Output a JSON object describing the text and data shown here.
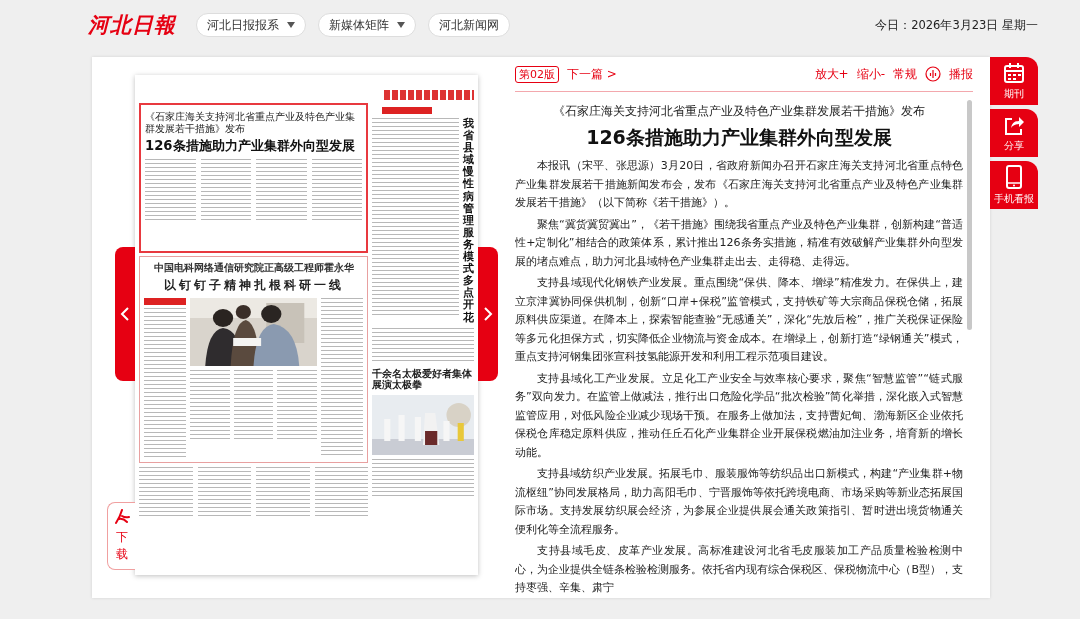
{
  "header": {
    "logo": "河北日報",
    "nav": [
      {
        "label": "河北日报报系",
        "dropdown": true
      },
      {
        "label": "新媒体矩阵",
        "dropdown": true
      },
      {
        "label": "河北新闻网",
        "dropdown": false
      }
    ],
    "date": "今日：2026年3月23日 星期一"
  },
  "newspaper": {
    "lead": {
      "kicker": "《石家庄海关支持河北省重点产业及特色产业集群发展若干措施》发布",
      "headline": "126条措施助力产业集群外向型发展"
    },
    "feature": {
      "kicker": "中国电科网络通信研究院正高级工程师霍永华",
      "headline": "以钉钉子精神扎根科研一线"
    },
    "side_headline": "我省县域慢性病管理服务模式多点开花",
    "photo_story": {
      "headline": "千余名太极爱好者集体展演太极拳"
    }
  },
  "download": "下载",
  "toolbar": {
    "page_badge": "第02版",
    "next": "下一篇 >",
    "zoom_in": "放大+",
    "zoom_out": "缩小-",
    "normal": "常规",
    "play": "播报"
  },
  "article": {
    "kicker": "《石家庄海关支持河北省重点产业及特色产业集群发展若干措施》发布",
    "title": "126条措施助力产业集群外向型发展",
    "paragraphs": [
      "本报讯（宋平、张思源）3月20日，省政府新闻办召开石家庄海关支持河北省重点特色产业集群发展若干措施新闻发布会，发布《石家庄海关支持河北省重点产业及特色产业集群发展若干措施》（以下简称《若干措施》）。",
      "聚焦“冀货冀贸冀出”，《若干措施》围绕我省重点产业及特色产业集群，创新构建“普适性+定制化”相结合的政策体系，累计推出126条务实措施，精准有效破解产业集群外向型发展的堵点难点，助力河北县域特色产业集群走出去、走得稳、走得远。",
      "支持县域现代化钢铁产业发展。重点围绕“保供、降本、增绿”精准发力。在保供上，建立京津冀协同保供机制，创新“口岸+保税”监管模式，支持铁矿等大宗商品保税仓储，拓展原料供应渠道。在降本上，探索智能查验“无感通关”，深化“先放后检”，推广关税保证保险等多元化担保方式，切实降低企业物流与资金成本。在增绿上，创新打造“绿钢通关”模式，重点支持河钢集团张宣科技氢能源开发和利用工程示范项目建设。",
      "支持县域化工产业发展。立足化工产业安全与效率核心要求，聚焦“智慧监管”“链式服务”双向发力。在监管上做减法，推行出口危险化学品“批次检验”简化举措，深化嵌入式智慧监管应用，对低风险企业减少现场干预。在服务上做加法，支持曹妃甸、渤海新区企业依托保税仓库稳定原料供应，推动任丘石化产业集群企业开展保税燃油加注业务，培育新的增长动能。",
      "支持县域纺织产业发展。拓展毛巾、服装服饰等纺织品出口新模式，构建“产业集群+物流枢纽”协同发展格局，助力高阳毛巾、宁晋服饰等依托跨境电商、市场采购等新业态拓展国际市场。支持发展纺织展会经济，为参展企业提供展会通关政策指引、暂时进出境货物通关便利化等全流程服务。",
      "支持县域毛皮、皮革产业发展。高标准建设河北省毛皮服装加工产品质量检验检测中心，为企业提供全链条检验检测服务。依托省内现有综合保税区、保税物流中心（B型），支持枣强、辛集、肃宁"
    ]
  },
  "side_tabs": [
    {
      "kind": "calendar",
      "label": "期刊"
    },
    {
      "kind": "share",
      "label": "分享"
    },
    {
      "kind": "phone",
      "label": "手机看报"
    }
  ]
}
